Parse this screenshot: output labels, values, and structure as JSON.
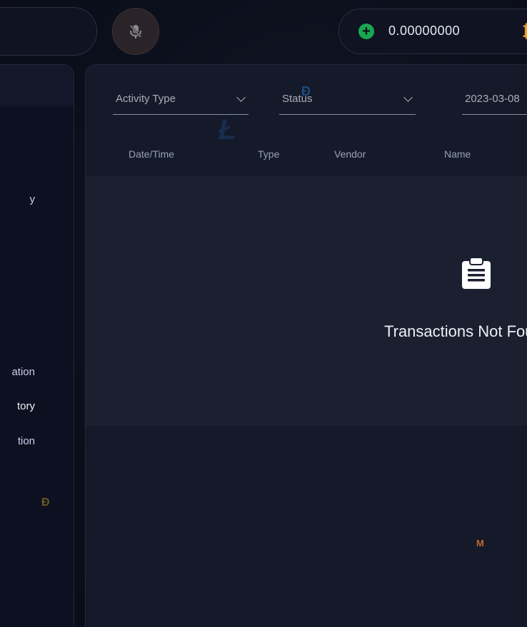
{
  "header": {
    "balance": "0.00000000",
    "add_funds_icon": "plus-circle-icon",
    "mic_icon": "microphone-off-icon",
    "currency_icon": "₿"
  },
  "sidebar": {
    "items": [
      {
        "label": "y"
      },
      {
        "label": "ation"
      },
      {
        "label": "tory"
      },
      {
        "label": "tion"
      }
    ],
    "coin_icon": "Ð"
  },
  "filters": {
    "activity_type": "Activity Type",
    "status": "Status",
    "date": "2023-03-08"
  },
  "table": {
    "columns": [
      "Date/Time",
      "Type",
      "Vendor",
      "Name"
    ]
  },
  "empty_state": {
    "message": "Transactions Not Found"
  },
  "decor": {
    "ltc": "Ł",
    "dash": "Đ",
    "xmr": "M"
  },
  "colors": {
    "accent_green": "#1aa752",
    "btc_orange": "#f59a23",
    "background": "#0b0f1c"
  }
}
